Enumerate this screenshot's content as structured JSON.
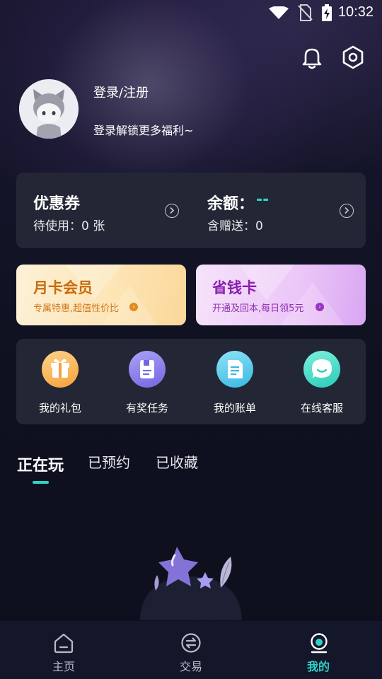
{
  "status_bar": {
    "time": "10:32",
    "icons": [
      "wifi-icon",
      "no-sim-icon",
      "battery-charging-icon"
    ]
  },
  "header": {
    "icons": [
      "bell-icon",
      "settings-icon"
    ]
  },
  "profile": {
    "title": "登录/注册",
    "subtitle": "登录解锁更多福利~"
  },
  "account_card": {
    "coupon_title": "优惠券",
    "coupon_sub": "待使用：0 张",
    "balance_title": "余额：",
    "balance_value": "--",
    "balance_sub": "含赠送：0"
  },
  "promos": {
    "month_title": "月卡会员",
    "month_sub": "专属特惠,超值性价比",
    "save_title": "省钱卡",
    "save_sub": "开通及回本,每日领5元"
  },
  "shortcuts": [
    {
      "label": "我的礼包",
      "icon": "gift-icon"
    },
    {
      "label": "有奖任务",
      "icon": "task-icon"
    },
    {
      "label": "我的账单",
      "icon": "bill-icon"
    },
    {
      "label": "在线客服",
      "icon": "chat-icon"
    }
  ],
  "tabs": [
    {
      "label": "正在玩",
      "active": true
    },
    {
      "label": "已预约",
      "active": false
    },
    {
      "label": "已收藏",
      "active": false
    }
  ],
  "bottom_nav": [
    {
      "label": "主页",
      "icon": "home-icon",
      "active": false
    },
    {
      "label": "交易",
      "icon": "trade-icon",
      "active": false
    },
    {
      "label": "我的",
      "icon": "profile-icon",
      "active": true
    }
  ],
  "colors": {
    "accent": "#2fd1c7",
    "card": "#232634",
    "background": "#0f1120",
    "month_title": "#c96a0b",
    "save_title": "#8a1fae"
  }
}
